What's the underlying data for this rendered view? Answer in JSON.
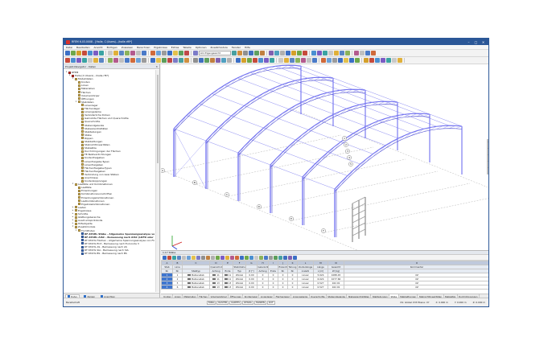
{
  "window": {
    "title": "RFEM 6.03.0008 - [Halle, C:\\Users\\...\\halle.rf6*]",
    "controls": [
      "–",
      "□",
      "✕"
    ]
  },
  "menu": [
    "Datei",
    "Bearbeiten",
    "Ansicht",
    "Einfügen",
    "Zuweisen",
    "Berechnen",
    "Ergebnisse",
    "Extras",
    "Tabelle",
    "Optionen",
    "Zusatzmodule",
    "Fenster",
    "Hilfe"
  ],
  "toolbar": {
    "loadcase_combo": "LK1   Eigengewicht",
    "view_combo": "1 - Global XYZ",
    "icon_colors": [
      "#3b6fc6",
      "#6fa84a",
      "#d4a02a",
      "#c64b3b",
      "#4a8fd1",
      "#7b5cc4",
      "#3aa3a3",
      "#c9c9c9",
      "#e0b03a",
      "#5a86c5",
      "#8bb35b",
      "#b45a8e",
      "#c0c0c0",
      "#4a7ac8",
      "#d06a3a",
      "#6aa0d8",
      "#9b9b9b",
      "#3b6fc6",
      "#e3c14d",
      "#5c9e5c",
      "#c04848",
      "#7c7cc8",
      "#48a0a0",
      "#d09040",
      "#909090",
      "#4070c0",
      "#60a060",
      "#c08040",
      "#8060b0",
      "#50a0c0",
      "#b0b0b0",
      "#3b6fc6",
      "#d4a02a",
      "#6fa84a",
      "#c64b3b",
      "#4a8fd1",
      "#7b5cc4",
      "#3aa3a3",
      "#c9c9c9",
      "#e0b03a",
      "#5a86c5",
      "#8bb35b",
      "#b45a8e",
      "#c0c0c0",
      "#4a7ac8",
      "#d06a3a",
      "#6aa0d8",
      "#9b9b9b",
      "#3b6fc6",
      "#e3c14d"
    ]
  },
  "navigator": {
    "title": "Projekt-Navigator - Daten",
    "close": "✕",
    "tree": [
      {
        "label": "RFEM",
        "depth": 0,
        "exp": "▾",
        "color": "#d9322a"
      },
      {
        "label": "Halle [C:\\Users\\...\\halle.rf6*]",
        "depth": 1,
        "exp": "▾",
        "color": "#d9322a"
      },
      {
        "label": "Modelldaten",
        "depth": 2,
        "exp": "▾",
        "color": "#e8c25a"
      },
      {
        "label": "Knoten",
        "depth": 3,
        "exp": "",
        "color": "#e8c25a"
      },
      {
        "label": "Linien",
        "depth": 3,
        "exp": "",
        "color": "#e8c25a"
      },
      {
        "label": "Materialien",
        "depth": 3,
        "exp": "",
        "color": "#e8c25a"
      },
      {
        "label": "Flächen",
        "depth": 3,
        "exp": "",
        "color": "#e8c25a"
      },
      {
        "label": "Volumenkörper",
        "depth": 3,
        "exp": "",
        "color": "#e8c25a"
      },
      {
        "label": "Öffnungen",
        "depth": 3,
        "exp": "",
        "color": "#e8c25a"
      },
      {
        "label": "Stabdaten",
        "depth": 3,
        "exp": "▾",
        "color": "#e8c25a"
      },
      {
        "label": "Linienlager",
        "depth": 4,
        "exp": "",
        "color": "#e8c25a"
      },
      {
        "label": "Flächenlager",
        "depth": 4,
        "exp": "",
        "color": "#e8c25a"
      },
      {
        "label": "Liniengelenke",
        "depth": 4,
        "exp": "",
        "color": "#e8c25a"
      },
      {
        "label": "Veränderliche Dicken",
        "depth": 4,
        "exp": "",
        "color": "#e8c25a"
      },
      {
        "label": "Geknickte Flächen und Querschnitte",
        "depth": 4,
        "exp": "",
        "color": "#e8c25a"
      },
      {
        "label": "Querschnitte",
        "depth": 4,
        "exp": "",
        "color": "#e8c25a"
      },
      {
        "label": "Stabendgelenke",
        "depth": 4,
        "exp": "",
        "color": "#e8c25a"
      },
      {
        "label": "Stabexzentrizitäten",
        "depth": 4,
        "exp": "",
        "color": "#e8c25a"
      },
      {
        "label": "Stabteilungen",
        "depth": 4,
        "exp": "",
        "color": "#e8c25a"
      },
      {
        "label": "Stäbe",
        "depth": 4,
        "exp": "",
        "color": "#e8c25a"
      },
      {
        "label": "Rippen",
        "depth": 4,
        "exp": "",
        "color": "#e8c25a"
      },
      {
        "label": "Stabbettungen",
        "depth": 4,
        "exp": "",
        "color": "#e8c25a"
      },
      {
        "label": "Stabnichtlinearitäten",
        "depth": 4,
        "exp": "",
        "color": "#e8c25a"
      },
      {
        "label": "Stabsätze",
        "depth": 4,
        "exp": "",
        "color": "#e8c25a"
      },
      {
        "label": "Durchdringungen der Flächen",
        "depth": 4,
        "exp": "",
        "color": "#e8c25a"
      },
      {
        "label": "FE-Netzverdichtungen",
        "depth": 4,
        "exp": "",
        "color": "#e8c25a"
      },
      {
        "label": "Knotenfreigaben",
        "depth": 4,
        "exp": "",
        "color": "#e8c25a"
      },
      {
        "label": "Linienfreigabe-Typen",
        "depth": 4,
        "exp": "",
        "color": "#e8c25a"
      },
      {
        "label": "Linienfreigaben",
        "depth": 4,
        "exp": "",
        "color": "#e8c25a"
      },
      {
        "label": "Flächenfreigabe-Typen",
        "depth": 4,
        "exp": "",
        "color": "#e8c25a"
      },
      {
        "label": "Flächenfreigaben",
        "depth": 4,
        "exp": "",
        "color": "#e8c25a"
      },
      {
        "label": "Verbindung von zwei Stäben",
        "depth": 4,
        "exp": "",
        "color": "#e8c25a"
      },
      {
        "label": "Anschlüsse",
        "depth": 4,
        "exp": "",
        "color": "#e8c25a"
      },
      {
        "label": "Knotenkopplungen",
        "depth": 4,
        "exp": "",
        "color": "#e8c25a"
      },
      {
        "label": "Lastfälle und Kombinationen",
        "depth": 2,
        "exp": "▾",
        "color": "#e8c25a"
      },
      {
        "label": "Lastfälle",
        "depth": 3,
        "exp": "",
        "color": "#e8c25a"
      },
      {
        "label": "Einwirkungen",
        "depth": 3,
        "exp": "",
        "color": "#e8c25a"
      },
      {
        "label": "Kombinationsvorschriften",
        "depth": 3,
        "exp": "",
        "color": "#e8c25a"
      },
      {
        "label": "Einwirkungskombinationen",
        "depth": 3,
        "exp": "",
        "color": "#e8c25a"
      },
      {
        "label": "Lastkombinationen",
        "depth": 3,
        "exp": "",
        "color": "#e8c25a"
      },
      {
        "label": "Ergebniskombinationen",
        "depth": 3,
        "exp": "",
        "color": "#e8c25a"
      },
      {
        "label": "Lasten",
        "depth": 2,
        "exp": "▸",
        "color": "#e8c25a"
      },
      {
        "label": "Ergebnisse",
        "depth": 2,
        "exp": "▸",
        "color": "#e8c25a"
      },
      {
        "label": "Schnitte",
        "depth": 2,
        "exp": "▸",
        "color": "#e8c25a"
      },
      {
        "label": "Glättungsbereiche",
        "depth": 2,
        "exp": "▸",
        "color": "#e8c25a"
      },
      {
        "label": "Ausdrucksprotokolle",
        "depth": 2,
        "exp": "▸",
        "color": "#e8c25a"
      },
      {
        "label": "Hilfsobjekte",
        "depth": 2,
        "exp": "▸",
        "color": "#e8c25a"
      },
      {
        "label": "Zusatzmodule",
        "depth": 2,
        "exp": "▾",
        "color": "#e8c25a"
      },
      {
        "label": "Formfinden",
        "depth": 3,
        "exp": "▾",
        "color": "#e8c25a"
      },
      {
        "label": "RF-STAHL Stäbe - Allgemeine Spannungsanalyse von S",
        "depth": 4,
        "exp": "",
        "color": "#3f76cf",
        "selected": true
      },
      {
        "label": "RF-STAHL AISC - Bemessung nach AISC (LRFD oder AS",
        "depth": 4,
        "exp": "",
        "color": "#3f76cf",
        "selected": true
      },
      {
        "label": "RF-STAHL Flächen - Allgemeine Spannungsanalyse von Fläch",
        "depth": 4,
        "exp": "",
        "color": "#3f76cf"
      },
      {
        "label": "RF-STAHL EC3 - Bemessung nach Eurocode 3",
        "depth": 4,
        "exp": "",
        "color": "#3f76cf"
      },
      {
        "label": "RF-STAHL AS - Bemessung nach AS",
        "depth": 4,
        "exp": "",
        "color": "#3f76cf"
      },
      {
        "label": "RF-STAHL SIA - Bemessung nach SIA",
        "depth": 4,
        "exp": "",
        "color": "#3f76cf"
      },
      {
        "label": "RF-STAHL BS - Bemessung nach BS",
        "depth": 4,
        "exp": "",
        "color": "#3f76cf"
      }
    ],
    "tabs": [
      "Daten",
      "Zeigen",
      "Ansichten"
    ]
  },
  "table": {
    "title": "1.17 Stäbe",
    "column_letters": [
      "A",
      "B",
      "C",
      "D",
      "E",
      "F",
      "G",
      "H",
      "I",
      "J",
      "K",
      "L",
      "M",
      "N",
      "O"
    ],
    "headers": [
      [
        "Stab",
        "Linie",
        "",
        "Querschnitt-Nr.",
        "",
        "Stabdrehung",
        "",
        "Gelenk-Nr.",
        "",
        "Exzentr.",
        "Teilung",
        "Voutenlänge",
        "Länge",
        "Gewicht",
        "Kommentar"
      ],
      [
        "Nr.",
        "Nr.",
        "Stabtyp",
        "Anfang",
        "Ende",
        "Typ",
        "β [°]",
        "Anfang",
        "Ende",
        "Nr.",
        "Nr.",
        "Anzahl",
        "L [m]",
        "W [kg]",
        ""
      ]
    ],
    "rows": [
      [
        "1",
        "1",
        "Balkenstab",
        "11",
        "11",
        "Winkel",
        "0.00",
        "0",
        "0",
        "0",
        "0",
        "Linear",
        "5.024",
        "1088.45",
        "XZ"
      ],
      [
        "2",
        "2",
        "Balkenstab",
        "11",
        "11",
        "Winkel",
        "0.00",
        "0",
        "0",
        "0",
        "0",
        "Linear",
        "6.024",
        "1077.66",
        "XZ"
      ],
      [
        "3",
        "5",
        "Balkenstab",
        "13",
        "13",
        "Winkel",
        "0.00",
        "0",
        "0",
        "0",
        "0",
        "Linear",
        "0.527",
        "162.91",
        "XZ"
      ],
      [
        "4",
        "6",
        "Balkenstab",
        "13",
        "13",
        "Winkel",
        "0.00",
        "0",
        "0",
        "0",
        "0",
        "Linear",
        "0.527",
        "162.91",
        "XZ"
      ]
    ],
    "tabs": [
      "Knoten",
      "Linien",
      "Materialien",
      "Flächen",
      "Volumenkörper",
      "Öffnungen",
      "Knotenlager",
      "Linienlager",
      "Flächenlager",
      "Liniengelenke",
      "Querschnitte",
      "Stabendgelenke",
      "Stabexzentrizitäten",
      "Stabteilungen",
      "Stäbe",
      "Stabbettungen",
      "Stabnichtlinearitäten",
      "Stabsätze",
      "Durchdringungen"
    ],
    "active_tab": "Stäbe"
  },
  "status": {
    "left": "Bereitschaft",
    "cells": [
      "FANG",
      "RASTER",
      "KARTES",
      "OFANG",
      "HLINIEN",
      "DXF"
    ],
    "right": [
      "KS: Global XYZ  Ebene: XY",
      "X: 0.000 m",
      "Y: 0.000 m",
      "Z: 0.000 m"
    ]
  },
  "viewport": {
    "frame_color": "#6e6ef0",
    "frame_dark": "#4a4ad0",
    "grid_labels": [
      "A",
      "B",
      "C",
      "D",
      "E",
      "F",
      "G",
      "1",
      "2",
      "3",
      "4",
      "5"
    ]
  }
}
